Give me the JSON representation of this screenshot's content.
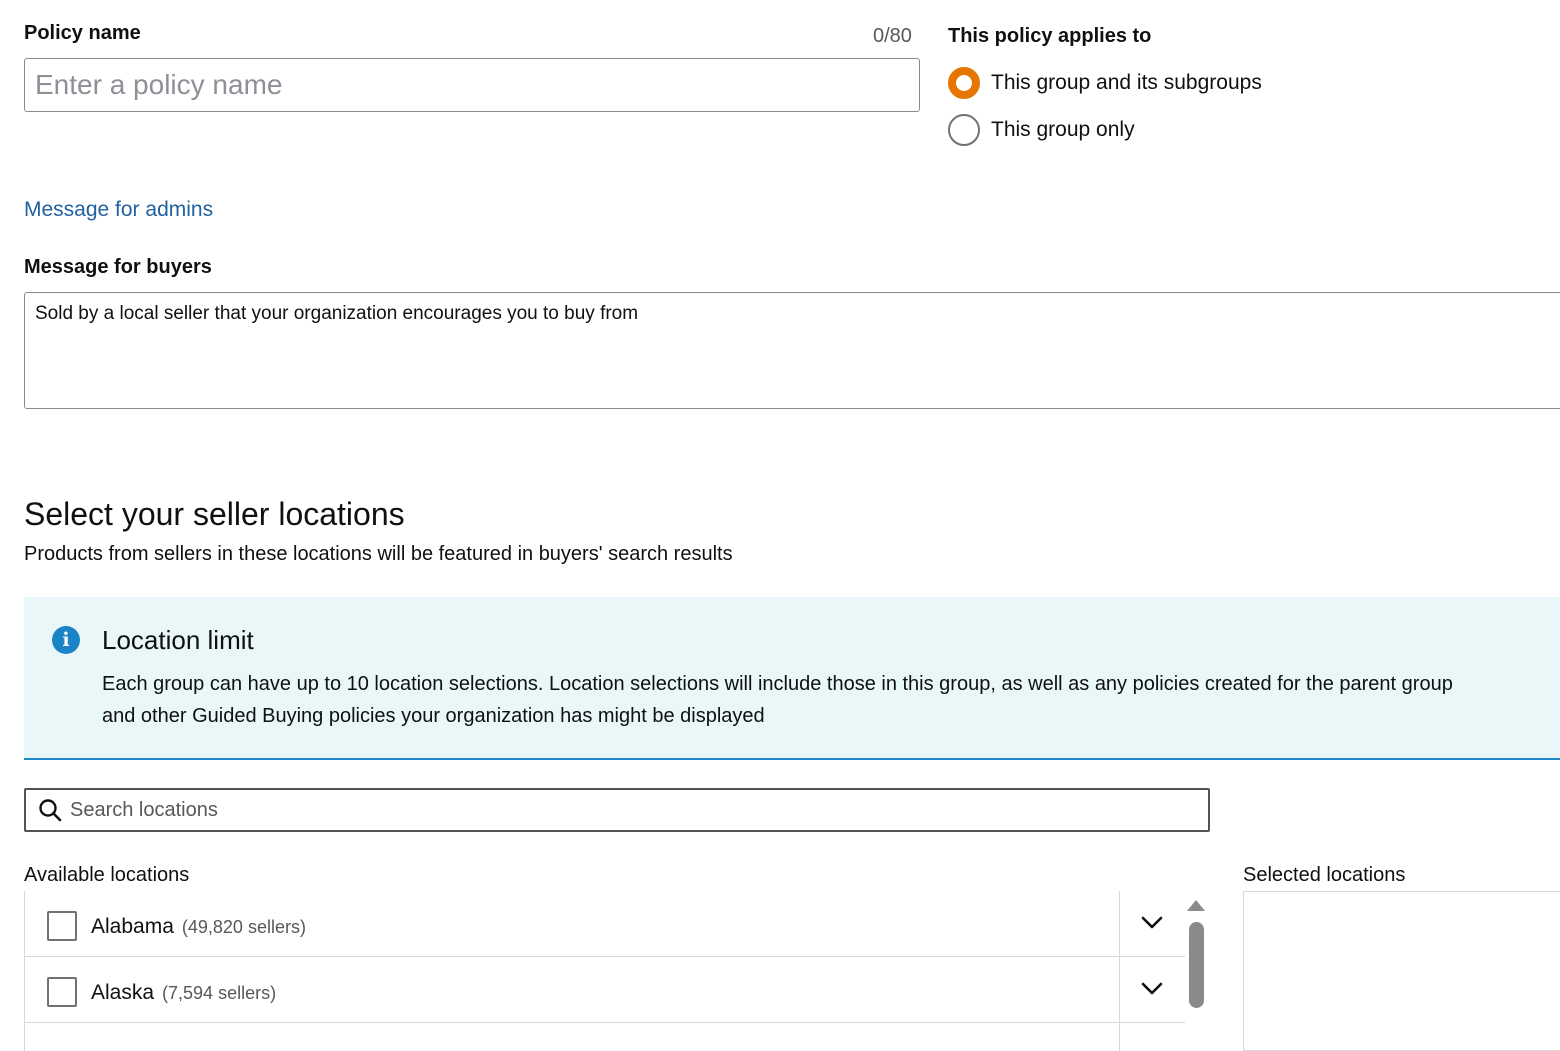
{
  "policy_name": {
    "label": "Policy name",
    "char_count": "0/80",
    "value": "",
    "placeholder": "Enter a policy name"
  },
  "applies_to": {
    "label": "This policy applies to",
    "options": [
      {
        "label": "This group and its subgroups",
        "selected": true
      },
      {
        "label": "This group only",
        "selected": false
      }
    ]
  },
  "message_for_admins": {
    "link_text": "Message for admins"
  },
  "message_for_buyers": {
    "label": "Message for buyers",
    "value": "Sold by a local seller that your organization encourages you to buy from"
  },
  "seller_locations": {
    "title": "Select your seller locations",
    "subtitle": "Products from sellers in these locations will be featured in buyers' search results"
  },
  "info_alert": {
    "title": "Location limit",
    "line1": "Each group can have up to 10 location selections. Location selections will include those in this group, as well as any policies created for the parent group",
    "line2": "and other Guided Buying policies your organization has might be displayed"
  },
  "search": {
    "value": "",
    "placeholder": "Search locations"
  },
  "available_locations": {
    "label": "Available locations",
    "items": [
      {
        "name": "Alabama",
        "count": "(49,820 sellers)",
        "checked": false
      },
      {
        "name": "Alaska",
        "count": "(7,594 sellers)",
        "checked": false
      }
    ]
  },
  "selected_locations": {
    "label": "Selected locations"
  },
  "colors": {
    "accent_radio": "#e77600",
    "link": "#2162a1",
    "info_background": "#e9f7f8",
    "info_icon": "#1a84c6"
  },
  "icons": {
    "info": "info-circle-icon",
    "search": "search-icon",
    "expand": "chevron-down-icon"
  }
}
